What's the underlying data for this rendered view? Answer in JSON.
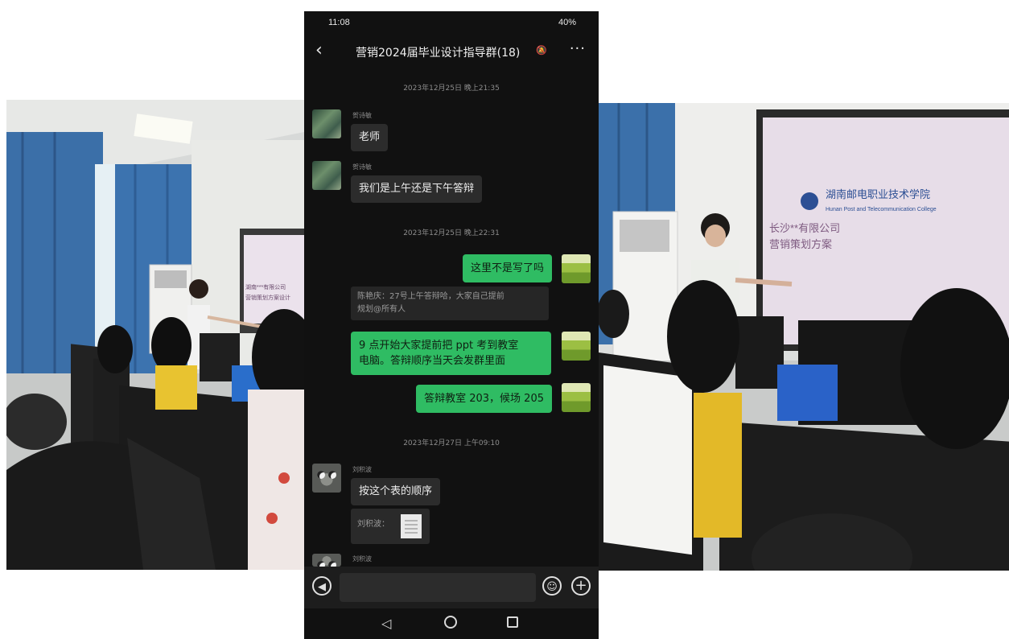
{
  "status": {
    "time": "11:08",
    "icons_text": "40%"
  },
  "chat": {
    "title": "营销2024届毕业设计指导群(18)",
    "messages": {
      "ts1": "2023年12月25日 晚上21:35",
      "m1_sender": "贺诗敏",
      "m1_text": "老师",
      "m2_sender": "贺诗敏",
      "m2_text": "我们是上午还是下午答辩",
      "ts2": "2023年12月25日 晚上22:31",
      "m3_text": "这里不是写了吗",
      "quote_line1": "陈艳庆：27号上午答辩哈，大家自己提前",
      "quote_line2": "规划@所有人",
      "m4_line1": "9 点开始大家提前把 ppt 考到教室",
      "m4_line2": "电脑。答辩顺序当天会发群里面",
      "m5_text": "答辩教室 203，候场 205",
      "ts3": "2023年12月27日 上午09:10",
      "m6_sender": "刘积波",
      "m6_text": "按这个表的顺序",
      "file_label": "刘积波：",
      "m7_sender": "刘积波"
    }
  },
  "photos": {
    "left_screen_text_1": "湖南***有限公司",
    "left_screen_text_2": "营销策划方案设计",
    "right_screen_school": "湖南邮电职业技术学院",
    "right_screen_school_en": "Hunan Post and Telecommunication College",
    "right_screen_line1": "长沙**有限公司",
    "right_screen_line2": "营销策划方案"
  },
  "colors": {
    "wechat_green": "#2fbc63",
    "phone_bg": "#111111"
  }
}
